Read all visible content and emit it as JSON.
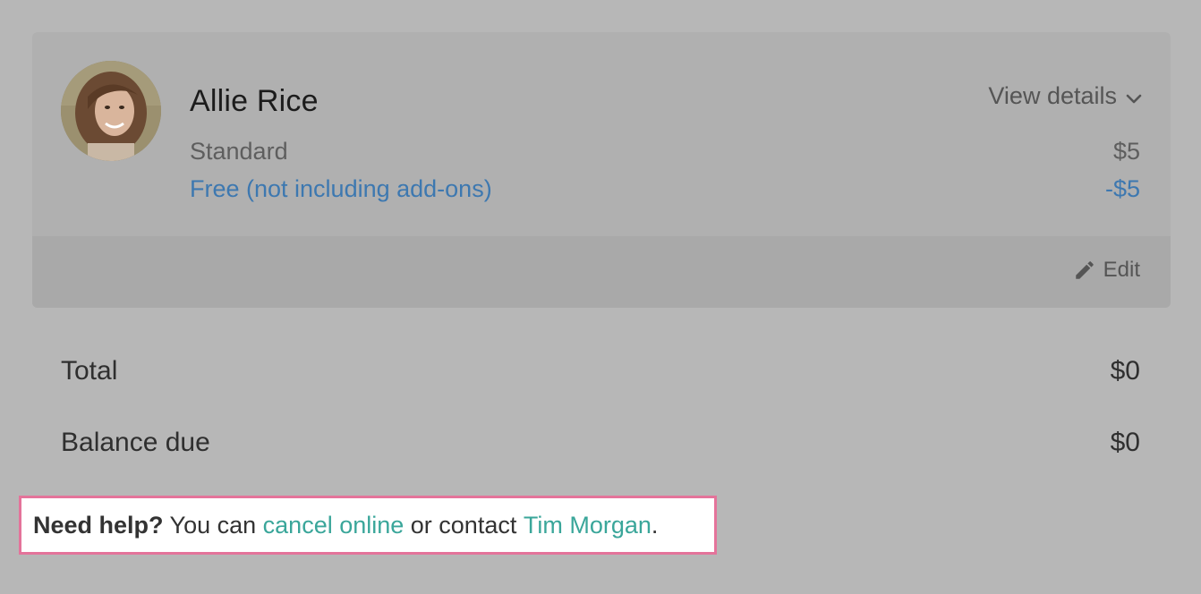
{
  "subscription": {
    "customer_name": "Allie Rice",
    "view_details_label": "View details",
    "plan_name": "Standard",
    "plan_price": "$5",
    "discount_label": "Free (not including add-ons)",
    "discount_price": "-$5",
    "edit_label": "Edit"
  },
  "summary": {
    "total_label": "Total",
    "total_value": "$0",
    "balance_label": "Balance due",
    "balance_value": "$0"
  },
  "help": {
    "bold_text": "Need help?",
    "text_1": " You can ",
    "cancel_link": "cancel online",
    "text_2": " or contact ",
    "contact_link": "Tim Morgan",
    "text_3": "."
  },
  "icons": {
    "chevron": "chevron-down-icon",
    "edit": "pencil-icon"
  },
  "colors": {
    "background": "#b7b7b7",
    "link_blue": "#3d78b0",
    "link_teal": "#3aa69a",
    "highlight_border": "#e4739a"
  }
}
